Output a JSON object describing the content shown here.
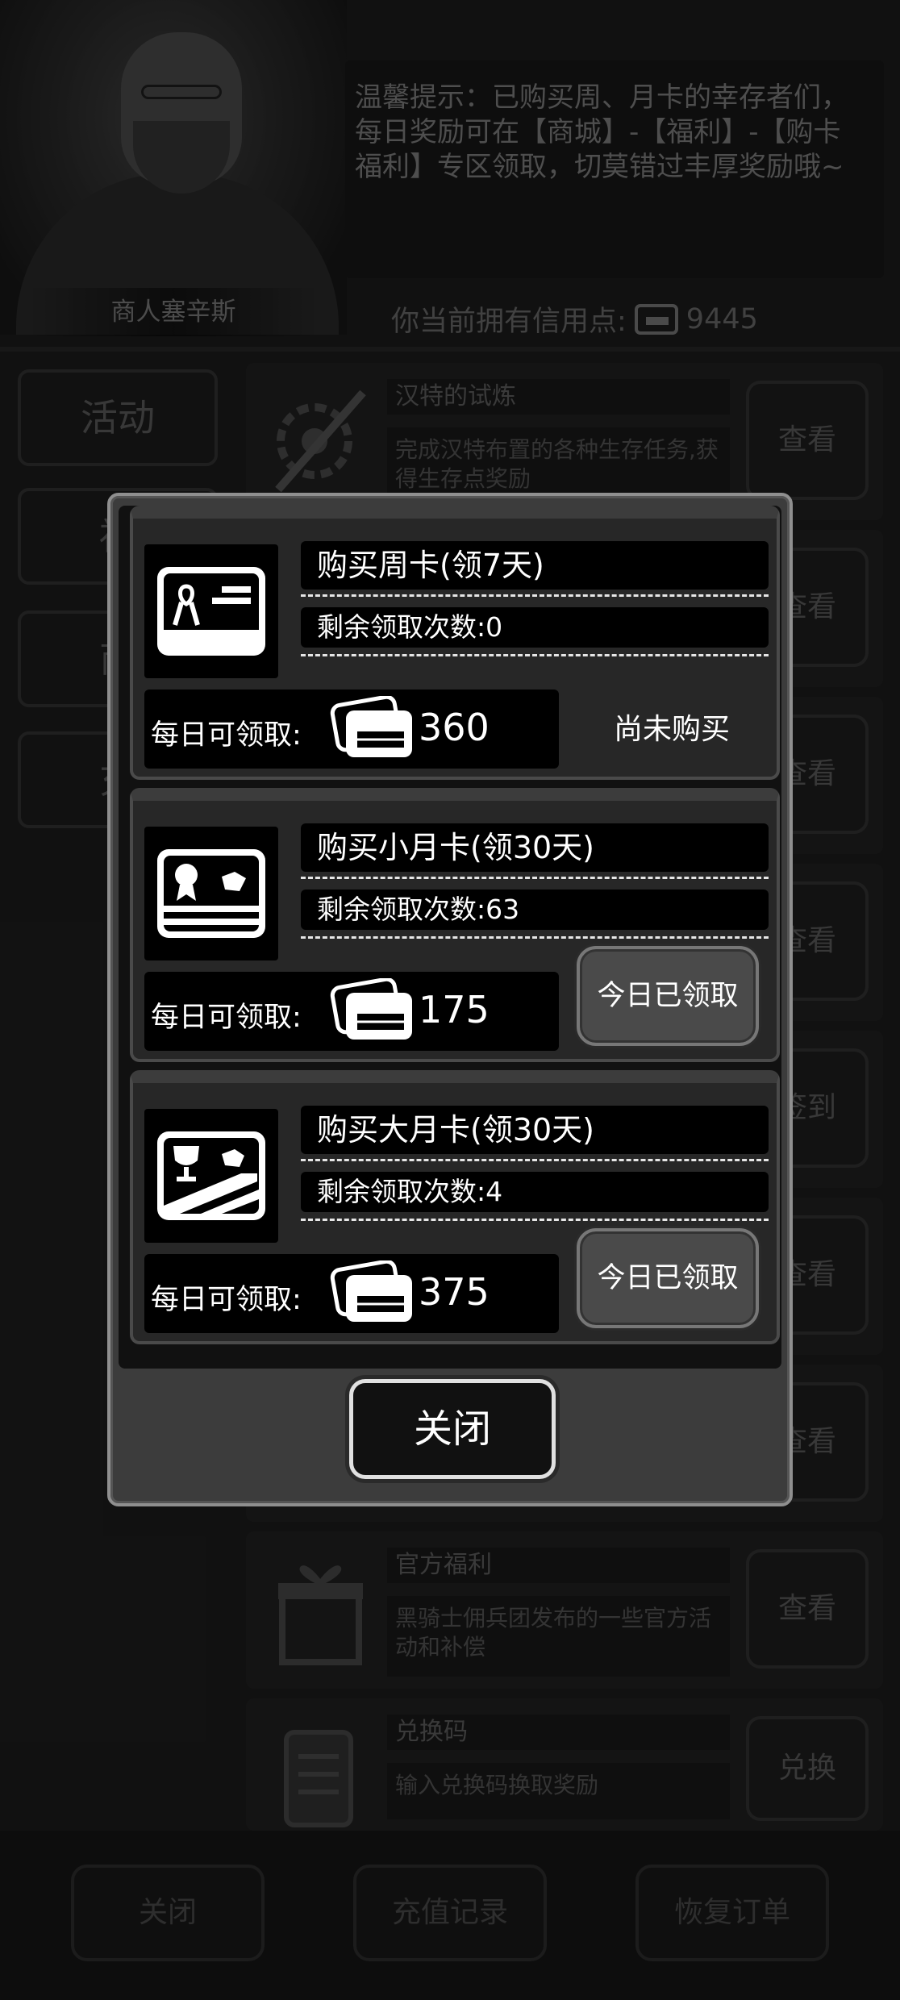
{
  "merchant": {
    "name": "商人塞辛斯"
  },
  "tip": {
    "text": "温馨提示：已购买周、月卡的幸存者们，每日奖励可在【商城】-【福利】-【购卡福利】专区领取，切莫错过丰厚奖励哦~"
  },
  "credits": {
    "label": "你当前拥有信用点:",
    "value": "9445"
  },
  "tabs": [
    {
      "label": "活动"
    },
    {
      "label": "福"
    },
    {
      "label": "商"
    },
    {
      "label": "充"
    }
  ],
  "activities": [
    {
      "title": "汉特的试炼",
      "desc": "完成汉特布置的各种生存任务,获得生存点奖励",
      "button": "查看"
    },
    {
      "title": "",
      "desc": "",
      "button": "查看"
    },
    {
      "title": "",
      "desc": "",
      "button": "查看"
    },
    {
      "title": "",
      "desc": "",
      "button": "查看"
    },
    {
      "title": "",
      "desc": "",
      "button": "签到"
    },
    {
      "title": "",
      "desc": "",
      "button": "查看"
    },
    {
      "title": "",
      "desc": "",
      "button": "查看"
    },
    {
      "title": "官方福利",
      "desc": "黑骑士佣兵团发布的一些官方活动和补偿",
      "button": "查看"
    },
    {
      "title": "兑换码",
      "desc": "输入兑换码换取奖励",
      "button": "兑换"
    }
  ],
  "bottom": {
    "close": "关闭",
    "history": "充值记录",
    "restore": "恢复订单"
  },
  "modal": {
    "daily_label": "每日可领取:",
    "cards": [
      {
        "title": "购买周卡(领7天)",
        "remaining": "剩余领取次数:0",
        "daily_value": "360",
        "status": "尚未购买",
        "icon": "ribbon-card-icon"
      },
      {
        "title": "购买小月卡(领30天)",
        "remaining": "剩余领取次数:63",
        "daily_value": "175",
        "status": "今日已领取",
        "icon": "medal-card-icon"
      },
      {
        "title": "购买大月卡(领30天)",
        "remaining": "剩余领取次数:4",
        "daily_value": "375",
        "status": "今日已领取",
        "icon": "trophy-card-icon"
      }
    ],
    "close_label": "关闭"
  }
}
